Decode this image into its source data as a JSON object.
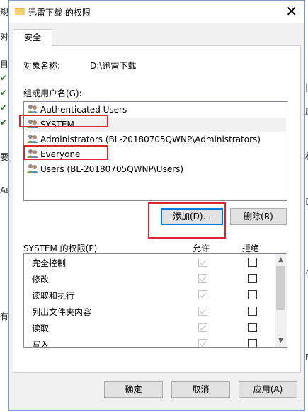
{
  "background": {
    "left_fragments": [
      "规",
      "对",
      "目",
      "✔",
      "✔",
      "✔",
      "✔",
      "要",
      "Au",
      "有"
    ],
    "right_fragments": [
      "|",
      "应",
      "权",
      "口",
      "作",
      "E"
    ]
  },
  "window": {
    "title": "迅雷下载 的权限",
    "close_label": "✕"
  },
  "tabs": [
    {
      "label": "安全"
    }
  ],
  "object": {
    "label": "对象名称:",
    "value": "D:\\迅雷下载"
  },
  "groups": {
    "label": "组或用户名(G):",
    "items": [
      {
        "name": "Authenticated Users"
      },
      {
        "name": "SYSTEM"
      },
      {
        "name": "Administrators (BL-20180705QWNP\\Administrators)"
      },
      {
        "name": "Everyone"
      },
      {
        "name": "Users (BL-20180705QWNP\\Users)"
      }
    ]
  },
  "buttons": {
    "add": "添加(D)...",
    "remove": "删除(R)",
    "ok": "确定",
    "cancel": "取消",
    "apply": "应用(A)"
  },
  "permissions": {
    "label": "SYSTEM 的权限(P)",
    "allow_header": "允许",
    "deny_header": "拒绝",
    "rows": [
      {
        "name": "完全控制",
        "allow": true,
        "deny": false
      },
      {
        "name": "修改",
        "allow": true,
        "deny": false
      },
      {
        "name": "读取和执行",
        "allow": true,
        "deny": false
      },
      {
        "name": "列出文件夹内容",
        "allow": true,
        "deny": false
      },
      {
        "name": "读取",
        "allow": true,
        "deny": false
      },
      {
        "name": "写入",
        "allow": true,
        "deny": false
      }
    ]
  },
  "colors": {
    "highlight": "#d9272e",
    "accent": "#0078d7"
  }
}
